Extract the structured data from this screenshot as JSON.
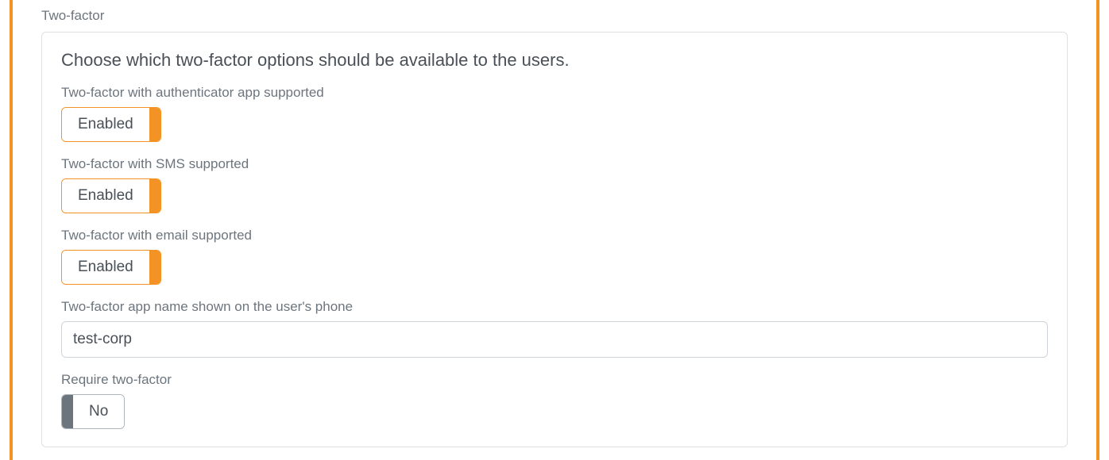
{
  "two_factor": {
    "section_label": "Two-factor",
    "description": "Choose which two-factor options should be available to the users.",
    "authenticator": {
      "label": "Two-factor with authenticator app supported",
      "value_label": "Enabled"
    },
    "sms": {
      "label": "Two-factor with SMS supported",
      "value_label": "Enabled"
    },
    "email": {
      "label": "Two-factor with email supported",
      "value_label": "Enabled"
    },
    "app_name": {
      "label": "Two-factor app name shown on the user's phone",
      "value": "test-corp"
    },
    "require": {
      "label": "Require two-factor",
      "value_label": "No"
    }
  }
}
